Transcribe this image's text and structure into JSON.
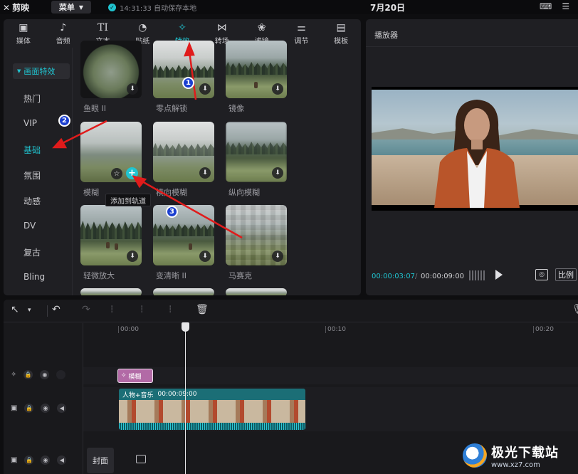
{
  "app": {
    "logo_text": "剪映",
    "menu_label": "菜单",
    "save_status": "14:31:33 自动保存本地",
    "date": "7月20日"
  },
  "tabs": [
    {
      "label": "媒体",
      "icon": "media-icon"
    },
    {
      "label": "音频",
      "icon": "audio-icon"
    },
    {
      "label": "文本",
      "icon": "text-icon"
    },
    {
      "label": "贴纸",
      "icon": "sticker-icon"
    },
    {
      "label": "特效",
      "icon": "effects-icon",
      "active": true
    },
    {
      "label": "转场",
      "icon": "transition-icon"
    },
    {
      "label": "滤镜",
      "icon": "filter-icon"
    },
    {
      "label": "调节",
      "icon": "adjust-icon"
    },
    {
      "label": "模板",
      "icon": "template-icon"
    }
  ],
  "categories": {
    "header": "画面特效",
    "items": [
      "热门",
      "VIP",
      "基础",
      "氛围",
      "动感",
      "DV",
      "复古",
      "Bling"
    ],
    "active": "基础"
  },
  "effects": [
    {
      "label": "鱼眼 II"
    },
    {
      "label": "零点解锁"
    },
    {
      "label": "镜像"
    },
    {
      "label": "模糊"
    },
    {
      "label": "横向模糊"
    },
    {
      "label": "纵向模糊"
    },
    {
      "label": "轻微放大"
    },
    {
      "label": "变清晰 II"
    },
    {
      "label": "马赛克"
    }
  ],
  "tooltip": "添加到轨道",
  "player": {
    "title": "播放器",
    "time_current": "00:00:03:07",
    "time_sep": "/",
    "time_total": "00:00:09:00",
    "ratio_label": "比例"
  },
  "timeline": {
    "ruler": [
      "00:00",
      "00:10",
      "00:20"
    ],
    "effect_clip_label": "模糊",
    "main_clip_label": "人物+音乐",
    "main_clip_duration": "00:00:09:00",
    "cover_label": "封面"
  },
  "annotations": [
    "1",
    "2",
    "3"
  ],
  "watermark": {
    "title": "极光下载站",
    "url": "www.xz7.com"
  },
  "colors": {
    "accent": "#20c4d0",
    "badge": "#1b3fd0",
    "arrow": "#e01b1b",
    "effect_clip": "#b26aa6",
    "main_clip": "#1b6e76"
  }
}
